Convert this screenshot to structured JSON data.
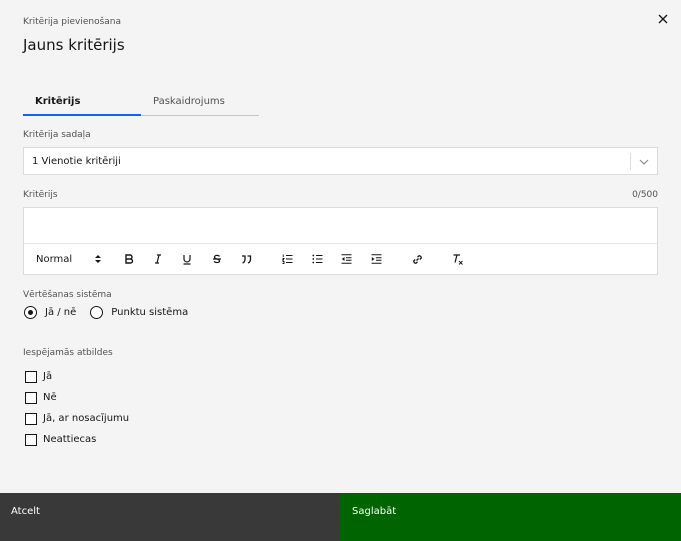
{
  "header": {
    "label": "Kritērija pievienošana",
    "title": "Jauns kritērijs",
    "close_icon": "close-icon"
  },
  "tabs": [
    {
      "label": "Kritērijs",
      "active": true
    },
    {
      "label": "Paskaidrojums",
      "active": false
    }
  ],
  "section_field": {
    "label": "Kritērija sadaļa",
    "value": "1 Vienotie kritēriji"
  },
  "criterion_field": {
    "label": "Kritērijs",
    "counter": "0/500",
    "toolbar": {
      "format_value": "Normal",
      "icons": [
        "bold-icon",
        "italic-icon",
        "underline-icon",
        "strike-icon",
        "quote-icon",
        "ordered-list-icon",
        "bullet-list-icon",
        "outdent-icon",
        "indent-icon",
        "link-icon",
        "clear-format-icon"
      ]
    }
  },
  "rating_system": {
    "label": "Vērtēšanas sistēma",
    "options": [
      {
        "label": "Jā / nē",
        "selected": true
      },
      {
        "label": "Punktu sistēma",
        "selected": false
      }
    ]
  },
  "possible_answers": {
    "label": "Iespējamās atbildes",
    "options": [
      {
        "label": "Jā",
        "checked": false
      },
      {
        "label": "Nē",
        "checked": false
      },
      {
        "label": "Jā, ar nosacījumu",
        "checked": false
      },
      {
        "label": "Neattiecas",
        "checked": false
      }
    ]
  },
  "footer": {
    "cancel_label": "Atcelt",
    "save_label": "Saglabāt"
  },
  "colors": {
    "tab_accent": "#0f62fe",
    "cancel_bg": "#393939",
    "save_bg": "#006400"
  }
}
